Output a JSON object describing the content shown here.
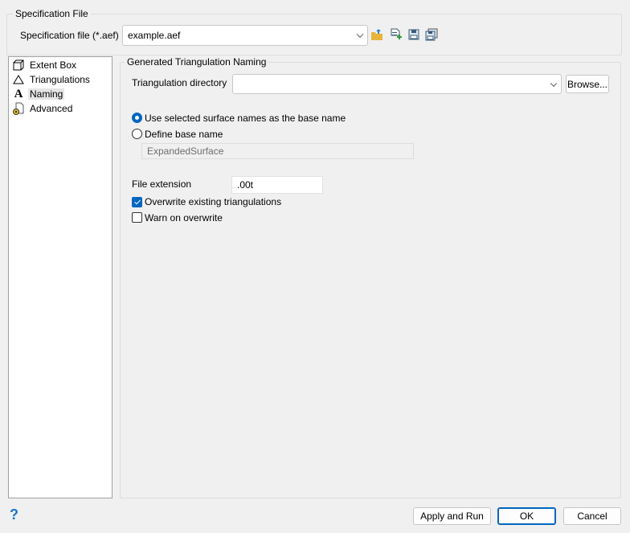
{
  "spec_group": {
    "title": "Specification File",
    "label": "Specification file (*.aef)",
    "value": "example.aef"
  },
  "toolbar_icons": [
    "open-folder-icon",
    "new-file-icon",
    "save-icon",
    "save-as-icon"
  ],
  "nav": {
    "items": [
      {
        "label": "Extent Box",
        "icon": "cube-icon"
      },
      {
        "label": "Triangulations",
        "icon": "triangle-icon"
      },
      {
        "label": "Naming",
        "icon": "font-a-icon",
        "selected": true
      },
      {
        "label": "Advanced",
        "icon": "settings-doc-icon"
      }
    ]
  },
  "naming": {
    "title": "Generated Triangulation Naming",
    "dir_label": "Triangulation directory",
    "dir_value": "",
    "browse": "Browse...",
    "radio_selected": "Use selected surface names as the base name",
    "radio_define": "Define base name",
    "base_name": "ExpandedSurface",
    "ext_label": "File extension",
    "ext_value": ".00t",
    "overwrite": "Overwrite existing triangulations",
    "overwrite_checked": true,
    "warn": "Warn on overwrite",
    "warn_checked": false
  },
  "footer": {
    "help": "?",
    "apply": "Apply and Run",
    "ok": "OK",
    "cancel": "Cancel"
  },
  "colors": {
    "accent": "#0067c0"
  }
}
